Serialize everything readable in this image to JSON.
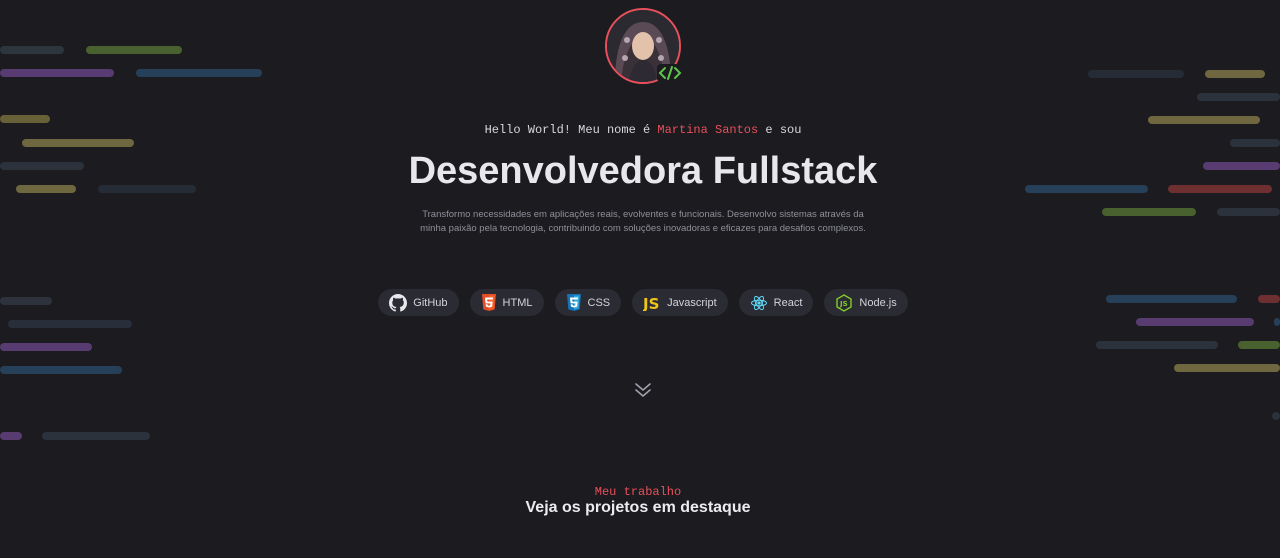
{
  "hero": {
    "greeting_prefix": "Hello World! Meu nome é ",
    "name": "Martina Santos",
    "greeting_suffix": " e sou",
    "title": "Desenvolvedora Fullstack",
    "description": "Transformo necessidades em aplicações reais, evolventes e funcionais. Desenvolvo sistemas através da minha paixão pela tecnologia, contribuindo com soluções inovadoras e eficazes para desafios complexos."
  },
  "skills": [
    {
      "label": "GitHub",
      "icon": "github-icon"
    },
    {
      "label": "HTML",
      "icon": "html5-icon"
    },
    {
      "label": "CSS",
      "icon": "css3-icon"
    },
    {
      "label": "Javascript",
      "icon": "javascript-icon"
    },
    {
      "label": "React",
      "icon": "react-icon"
    },
    {
      "label": "Node.js",
      "icon": "nodejs-icon"
    }
  ],
  "scroll": {
    "icon": "double-chevron-down-icon"
  },
  "projects": {
    "kicker": "Meu trabalho",
    "title": "Veja os projetos em destaque"
  },
  "colors": {
    "background": "#1b1b20",
    "accent": "#e8505b",
    "chip": "#2a2b33"
  }
}
